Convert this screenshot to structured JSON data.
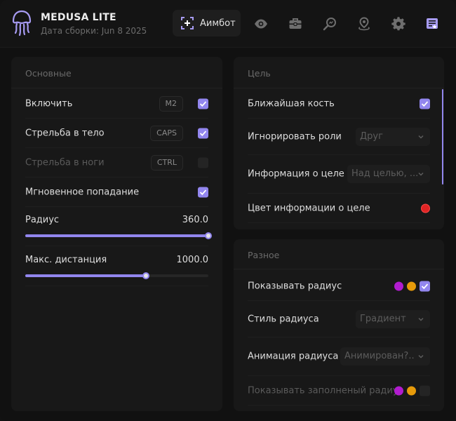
{
  "app": {
    "title": "MEDUSA LITE",
    "subtitle": "Дата сборки: Jun 8 2025"
  },
  "nav": {
    "active_tab": "Аимбот",
    "icons": [
      "crosshair-icon",
      "eye-icon",
      "briefcase-icon",
      "magnifier-icon",
      "location-pin-icon",
      "gear-icon",
      "config-icon"
    ]
  },
  "colors": {
    "accent": "#9286ee",
    "red": "#e02424",
    "magenta": "#b11ccf",
    "orange": "#e69a0a"
  },
  "basic": {
    "title": "Основные",
    "enable": {
      "label": "Включить",
      "key": "M2",
      "checked": true
    },
    "body_shot": {
      "label": "Стрельба в тело",
      "key": "CAPS",
      "checked": true
    },
    "leg_shot": {
      "label": "Стрельба в ноги",
      "key": "CTRL",
      "checked": false
    },
    "instant_hit": {
      "label": "Мгновенное попадание",
      "checked": true
    },
    "radius": {
      "label": "Радиус",
      "value": "360.0",
      "fraction": 1.0
    },
    "max_distance": {
      "label": "Макс. дистанция",
      "value": "1000.0",
      "fraction": 0.66
    }
  },
  "target": {
    "title": "Цель",
    "nearest_bone": {
      "label": "Ближайшая кость",
      "checked": true
    },
    "ignore_roles": {
      "label": "Игнорировать роли",
      "value": "Друг"
    },
    "target_info": {
      "label": "Информация о целе",
      "value": "Над целью, ..."
    },
    "target_info_color": {
      "label": "Цвет информации о целе"
    }
  },
  "misc": {
    "title": "Разное",
    "show_radius": {
      "label": "Показывать радиус",
      "checked": true
    },
    "radius_style": {
      "label": "Стиль радиуса",
      "value": "Градиент"
    },
    "radius_animation": {
      "label": "Анимация радиуса",
      "value": "Анимирован?.."
    },
    "show_filled_radius": {
      "label": "Показывать заполненый радиус",
      "checked": false
    }
  }
}
